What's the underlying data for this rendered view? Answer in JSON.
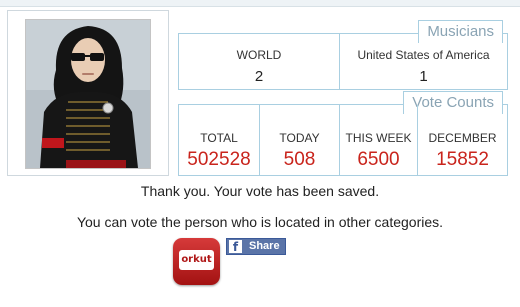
{
  "musicians": {
    "tab_label": "Musicians",
    "columns": [
      {
        "label": "WORLD",
        "value": "2"
      },
      {
        "label": "United States of America",
        "value": "1"
      }
    ]
  },
  "vote_counts": {
    "tab_label": "Vote Counts",
    "columns": [
      {
        "label": "TOTAL",
        "value": "502528"
      },
      {
        "label": "TODAY",
        "value": "508"
      },
      {
        "label": "THIS WEEK",
        "value": "6500"
      },
      {
        "label": "DECEMBER",
        "value": "15852"
      }
    ]
  },
  "messages": {
    "saved": "Thank you. Your vote has been saved.",
    "other_categories": "You can vote the person who is located in other categories."
  },
  "share": {
    "orkut_label": "orkut",
    "facebook_icon": "f",
    "facebook_label": "Share"
  },
  "colors": {
    "border": "#a9cfe1",
    "tab_text": "#8aa4b4",
    "vote_value": "#c9241c"
  }
}
